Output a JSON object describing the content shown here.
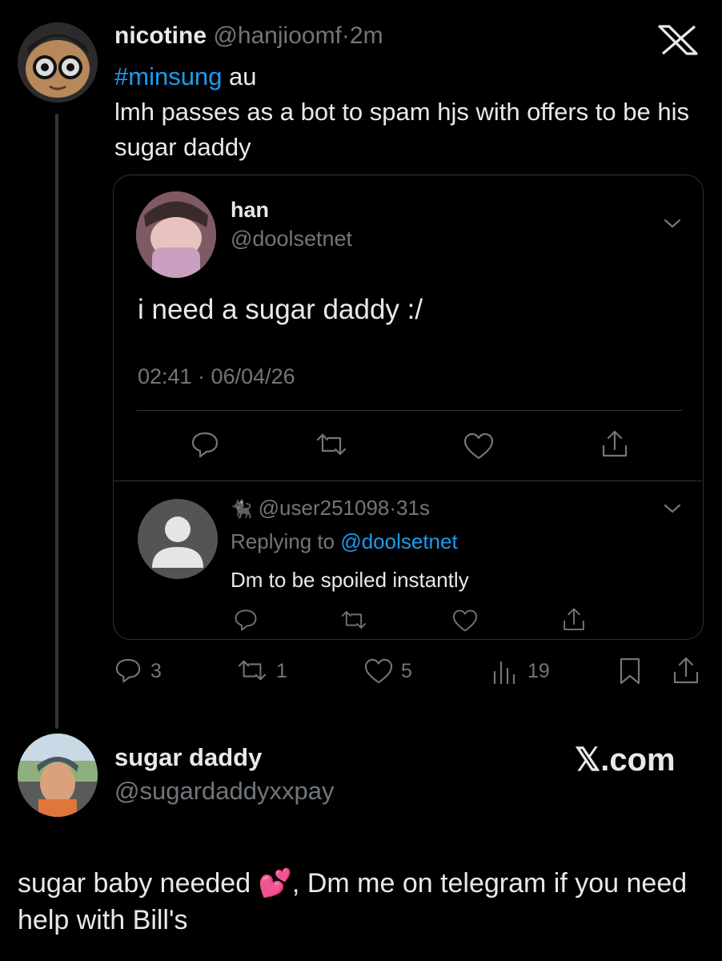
{
  "tweet": {
    "display_name": "nicotine",
    "handle": "@hanjioomf",
    "separator": "·",
    "time": "2m",
    "hashtag": "#minsung",
    "hashtag_suffix": " au",
    "text": "lmh passes as a bot to spam hjs with offers to be his sugar daddy",
    "brand_icon": "x-logo-icon",
    "actions": {
      "replies": "3",
      "retweets": "1",
      "likes": "5",
      "views": "19"
    }
  },
  "quoted": {
    "display_name": "han",
    "handle": "@doolsetnet",
    "text": "i need a sugar daddy :/",
    "timestamp": "02:41 · 06/04/26"
  },
  "reply": {
    "emoji": "🐈‍⬛",
    "handle": "@user251098",
    "separator": "·",
    "time": "31s",
    "replying_label": "Replying to",
    "replying_handle": "@doolsetnet",
    "text": "Dm to be spoiled instantly"
  },
  "ad": {
    "display_name": "sugar daddy",
    "handle": "@sugardaddyxxpay",
    "brand_text": "𝕏.com",
    "text_before": "sugar baby needed ",
    "emoji": "💕",
    "text_after": ", Dm me on telegram if you need help with Bill's"
  },
  "colors": {
    "background": "#000000",
    "text": "#e7e9ea",
    "muted": "#71767b",
    "link": "#1d9bf0",
    "border": "#2f3336"
  }
}
